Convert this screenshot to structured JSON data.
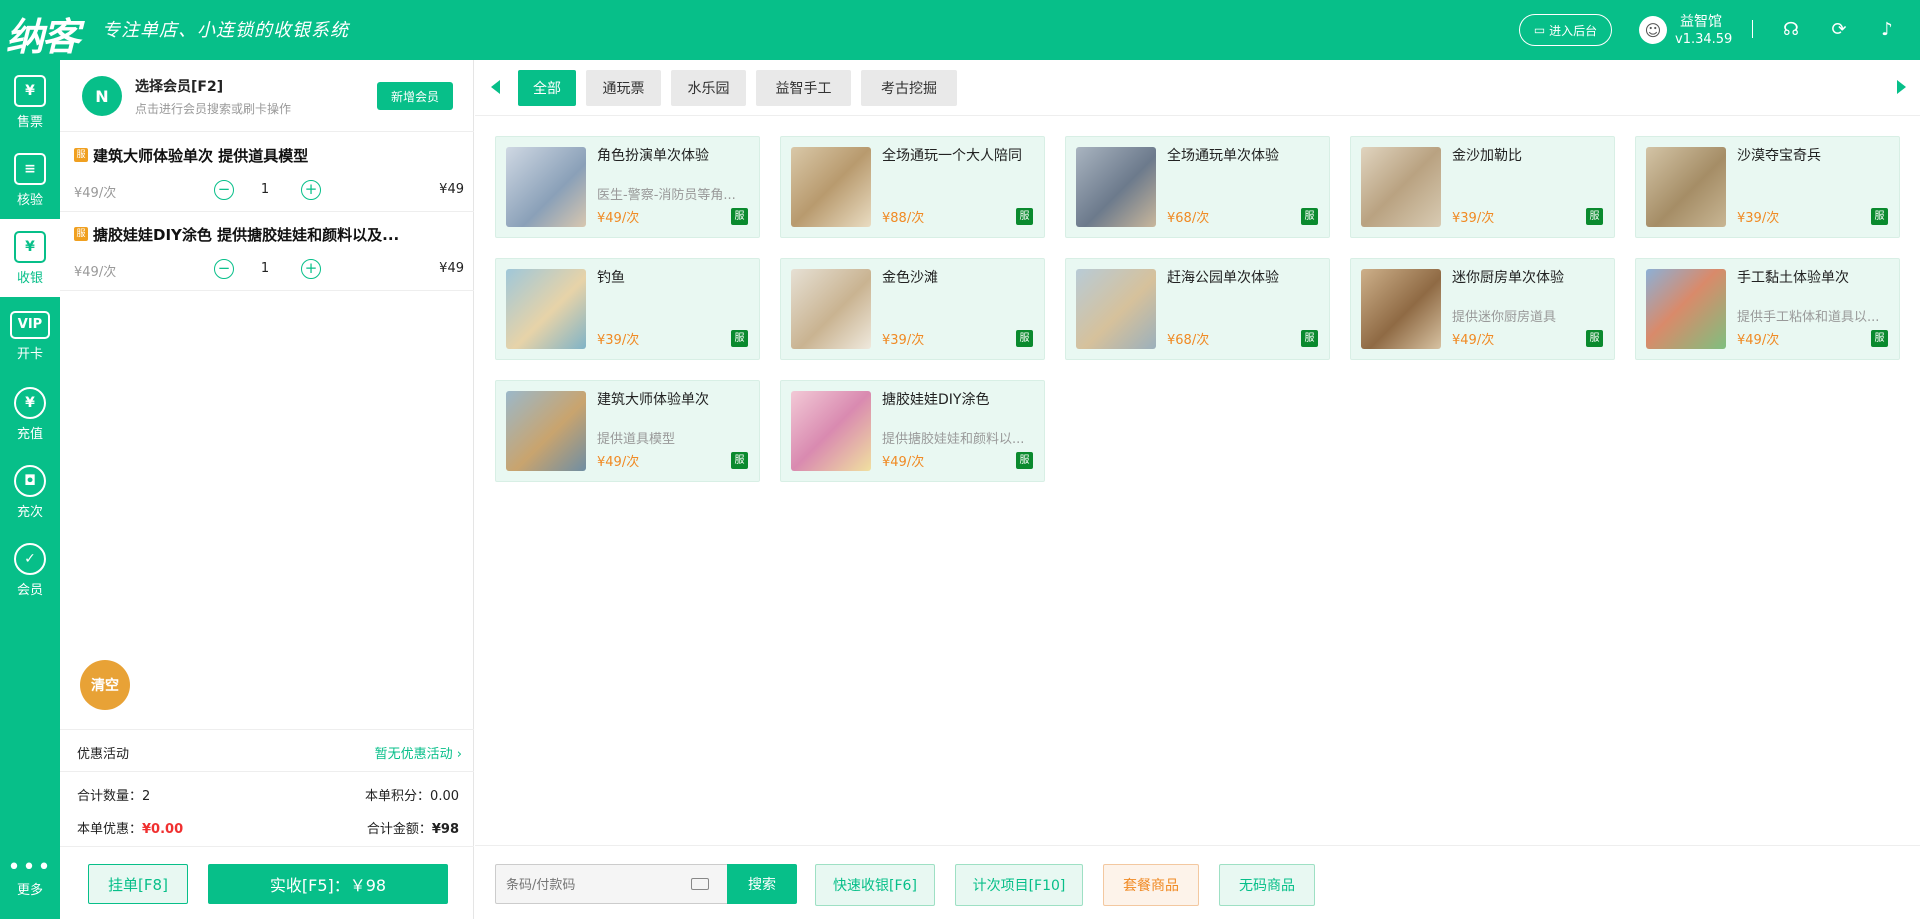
{
  "app": {
    "logo": "纳客",
    "slogan": "专注单店、小连锁的收银系统",
    "admin_button": "进入后台",
    "user_name": "益智馆",
    "version": "v1.34.59"
  },
  "sidebar": {
    "items": [
      {
        "label": "售票",
        "icon": "ticket-icon"
      },
      {
        "label": "核验",
        "icon": "verify-icon"
      },
      {
        "label": "收银",
        "icon": "cashier-icon"
      },
      {
        "label": "开卡",
        "icon": "vip-card-icon"
      },
      {
        "label": "充值",
        "icon": "recharge-icon"
      },
      {
        "label": "充次",
        "icon": "recharge-times-icon"
      },
      {
        "label": "会员",
        "icon": "member-icon"
      }
    ],
    "more": "更多",
    "active": "收银"
  },
  "member": {
    "title": "选择会员[F2]",
    "subtitle": "点击进行会员搜索或刷卡操作",
    "new_button": "新增会员"
  },
  "cart": {
    "items": [
      {
        "badge": "服",
        "name": "建筑大师体验单次 提供道具模型",
        "unit_price": "¥49/次",
        "qty": "1",
        "total": "¥49"
      },
      {
        "badge": "服",
        "name": "搪胶娃娃DIY涂色 提供搪胶娃娃和颜料以及...",
        "unit_price": "¥49/次",
        "qty": "1",
        "total": "¥49"
      }
    ],
    "clear_button": "清空"
  },
  "promo": {
    "label": "优惠活动",
    "value": "暂无优惠活动"
  },
  "summary": {
    "qty_label": "合计数量：",
    "qty_value": "2",
    "points_label": "本单积分：",
    "points_value": "0.00",
    "discount_label": "本单优惠：",
    "discount_value": "¥0.00",
    "total_label": "合计金额：",
    "total_value": "¥98"
  },
  "actions": {
    "hold": "挂单[F8]",
    "pay": "实收[F5]：￥98"
  },
  "tabs": [
    "全部",
    "通玩票",
    "水乐园",
    "益智手工",
    "考古挖掘"
  ],
  "products": [
    {
      "name": "角色扮演单次体验",
      "desc": "医生-警察-消防员等角...",
      "price": "¥49/次",
      "tag": "服"
    },
    {
      "name": "全场通玩一个大人陪同",
      "desc": "",
      "price": "¥88/次",
      "tag": "服"
    },
    {
      "name": "全场通玩单次体验",
      "desc": "",
      "price": "¥68/次",
      "tag": "服"
    },
    {
      "name": "金沙加勒比",
      "desc": "",
      "price": "¥39/次",
      "tag": "服"
    },
    {
      "name": "沙漠夺宝奇兵",
      "desc": "",
      "price": "¥39/次",
      "tag": "服"
    },
    {
      "name": "钓鱼",
      "desc": "",
      "price": "¥39/次",
      "tag": "服"
    },
    {
      "name": "金色沙滩",
      "desc": "",
      "price": "¥39/次",
      "tag": "服"
    },
    {
      "name": "赶海公园单次体验",
      "desc": "",
      "price": "¥68/次",
      "tag": "服"
    },
    {
      "name": "迷你厨房单次体验",
      "desc": "提供迷你厨房道具",
      "price": "¥49/次",
      "tag": "服"
    },
    {
      "name": "手工黏土体验单次",
      "desc": "提供手工粘体和道具以...",
      "price": "¥49/次",
      "tag": "服"
    },
    {
      "name": "建筑大师体验单次",
      "desc": "提供道具模型",
      "price": "¥49/次",
      "tag": "服"
    },
    {
      "name": "搪胶娃娃DIY涂色",
      "desc": "提供搪胶娃娃和颜料以...",
      "price": "¥49/次",
      "tag": "服"
    }
  ],
  "search": {
    "placeholder": "条码/付款码",
    "button": "搜索"
  },
  "function_buttons": {
    "quick": "快速收银[F6]",
    "times": "计次项目[F10]",
    "package": "套餐商品",
    "nocode": "无码商品"
  },
  "colors": {
    "primary": "#07bf89",
    "price": "#f08a24",
    "danger": "#f03030"
  }
}
